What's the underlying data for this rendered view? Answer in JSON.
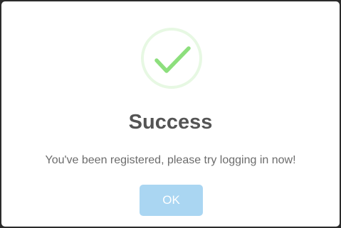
{
  "dialog": {
    "title": "Success",
    "message": "You've been registered, please try logging in now!",
    "ok_label": "OK",
    "icon": "success-check-icon"
  },
  "colors": {
    "check": "#8ddf7d",
    "ring": "#e7f8e3",
    "button": "#aad6f2",
    "title": "#545454",
    "message": "#6c6c6c"
  }
}
